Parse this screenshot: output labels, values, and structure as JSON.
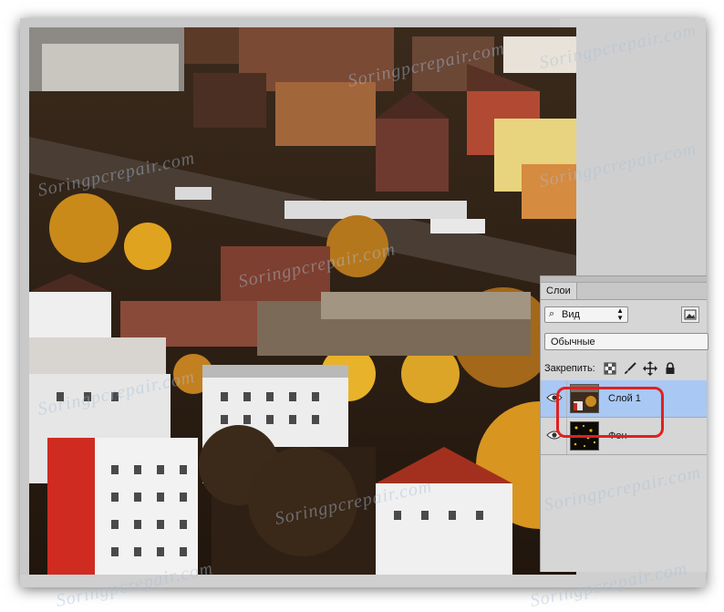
{
  "watermark": "Soringpcrepair.com",
  "layers_panel": {
    "tab_label": "Слои",
    "filter_kind": "Вид",
    "blend_mode": "Обычные",
    "lock_label": "Закрепить:",
    "layers": [
      {
        "name": "Слой 1",
        "visible": true,
        "selected": true
      },
      {
        "name": "Фон",
        "visible": true,
        "selected": false
      }
    ]
  },
  "colors": {
    "selection": "#a9c8f3",
    "highlight": "#e02020",
    "panel": "#d6d6d6"
  },
  "icons": [
    "search-icon",
    "image-filter-icon",
    "lock-pixels-icon",
    "lock-brush-icon",
    "lock-move-icon",
    "lock-all-icon",
    "eye-icon"
  ]
}
